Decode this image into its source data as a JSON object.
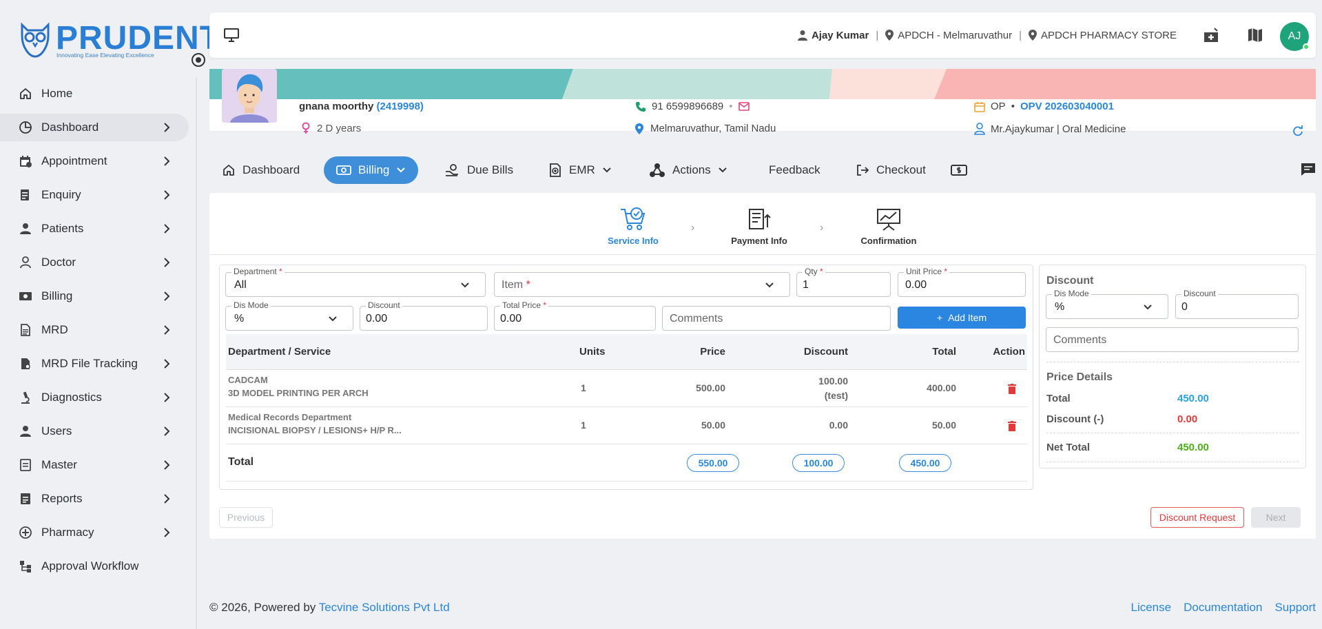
{
  "brand": {
    "name": "PRUDENT",
    "tagline": "Innovating Ease Elevating Excellence"
  },
  "sidebar": {
    "items": [
      {
        "label": "Home",
        "icon": "home-icon"
      },
      {
        "label": "Dashboard",
        "icon": "dashboard-icon"
      },
      {
        "label": "Appointment",
        "icon": "calendar-icon"
      },
      {
        "label": "Enquiry",
        "icon": "enquiry-icon"
      },
      {
        "label": "Patients",
        "icon": "person-icon"
      },
      {
        "label": "Doctor",
        "icon": "doctor-icon"
      },
      {
        "label": "Billing",
        "icon": "billing-icon"
      },
      {
        "label": "MRD",
        "icon": "document-icon"
      },
      {
        "label": "MRD File Tracking",
        "icon": "file-tracking-icon"
      },
      {
        "label": "Diagnostics",
        "icon": "microscope-icon"
      },
      {
        "label": "Users",
        "icon": "users-icon"
      },
      {
        "label": "Master",
        "icon": "master-icon"
      },
      {
        "label": "Reports",
        "icon": "reports-icon"
      },
      {
        "label": "Pharmacy",
        "icon": "pharmacy-icon"
      },
      {
        "label": "Approval Workflow",
        "icon": "workflow-icon"
      }
    ]
  },
  "header": {
    "user": "Ajay Kumar",
    "branch": "APDCH - Melmaruvathur",
    "store": "APDCH PHARMACY STORE",
    "avatar_initials": "AJ"
  },
  "patient": {
    "name": "gnana moorthy",
    "id": "(2419998)",
    "age": "2 D years",
    "phone": "91 6599896689",
    "address": "Melmaruvathur, Tamil Nadu",
    "visit_type": "OP",
    "visit_id": "OPV 202603040001",
    "doctor": "Mr.Ajaykumar | Oral Medicine"
  },
  "tabs": {
    "dashboard": "Dashboard",
    "billing": "Billing",
    "due_bills": "Due Bills",
    "emr": "EMR",
    "actions": "Actions",
    "feedback": "Feedback",
    "checkout": "Checkout"
  },
  "steps": {
    "service": "Service Info",
    "payment": "Payment Info",
    "confirm": "Confirmation"
  },
  "form": {
    "department_label": "Department",
    "department_value": "All",
    "item_placeholder": "Item",
    "qty_label": "Qty",
    "qty_value": "1",
    "unit_price_label": "Unit Price",
    "unit_price_value": "0.00",
    "dis_mode_label": "Dis Mode",
    "dis_mode_value": "%",
    "discount_label": "Discount",
    "discount_value": "0.00",
    "total_price_label": "Total Price",
    "total_price_value": "0.00",
    "comments_placeholder": "Comments",
    "add_item": "Add Item"
  },
  "table": {
    "headers": {
      "service": "Department / Service",
      "units": "Units",
      "price": "Price",
      "discount": "Discount",
      "total": "Total",
      "action": "Action"
    },
    "rows": [
      {
        "dept": "CADCAM",
        "service": "3D MODEL PRINTING PER ARCH",
        "units": "1",
        "price": "500.00",
        "discount": "100.00",
        "discount_note": "(test)",
        "total": "400.00"
      },
      {
        "dept": "Medical Records Department",
        "service": "INCISIONAL BIOPSY / LESIONS+ H/P R...",
        "units": "1",
        "price": "50.00",
        "discount": "0.00",
        "discount_note": "",
        "total": "50.00"
      }
    ],
    "total_label": "Total",
    "total_price": "550.00",
    "total_discount": "100.00",
    "total_amount": "450.00"
  },
  "side": {
    "title": "Discount",
    "dis_mode_label": "Dis Mode",
    "dis_mode_value": "%",
    "discount_label": "Discount",
    "discount_value": "0",
    "comments_placeholder": "Comments",
    "price_details": "Price Details",
    "total_label": "Total",
    "total_value": "450.00",
    "discount_minus_label": "Discount (-)",
    "discount_minus_value": "0.00",
    "net_label": "Net Total",
    "net_value": "450.00"
  },
  "buttons": {
    "previous": "Previous",
    "discount_request": "Discount Request",
    "next": "Next"
  },
  "footer": {
    "copyright": "© 2026, Powered by",
    "company": "Tecvine Solutions Pvt Ltd",
    "license": "License",
    "documentation": "Documentation",
    "support": "Support"
  },
  "colors": {
    "accent": "#2a86d9",
    "active_tab": "#3e8ed9",
    "danger": "#e03a3a",
    "success": "#4caf18",
    "avatar": "#1ea37a"
  }
}
